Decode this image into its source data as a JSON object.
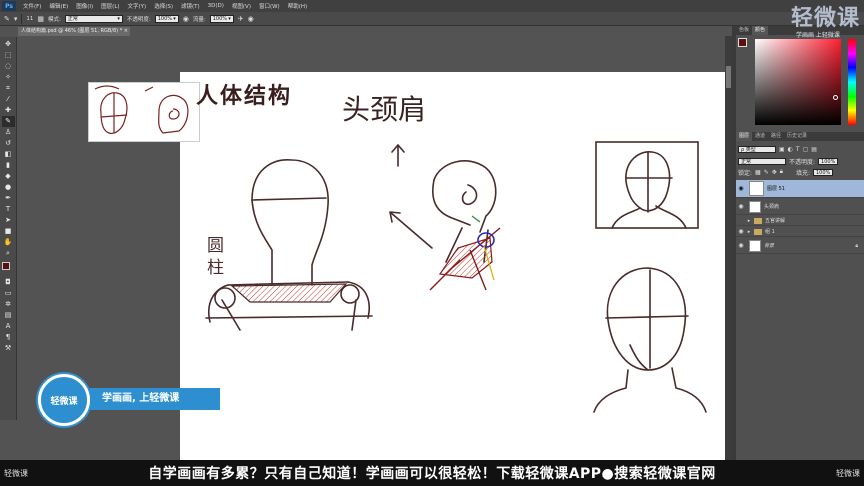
{
  "app": {
    "logo": "Ps"
  },
  "menu": [
    "文件(F)",
    "编辑(E)",
    "图像(I)",
    "图层(L)",
    "文字(Y)",
    "选择(S)",
    "滤镜(T)",
    "3D(D)",
    "视图(V)",
    "窗口(W)",
    "帮助(H)"
  ],
  "options": {
    "brush_size": "11",
    "mode_label": "模式:",
    "mode_value": "正常",
    "opacity_label": "不透明度:",
    "opacity_value": "100%",
    "flow_label": "流量:",
    "flow_value": "100%"
  },
  "document": {
    "tab_title": "人体结构篇.psd @ 46% (图层 51, RGB/8) *",
    "close": "×"
  },
  "canvas_text": {
    "title_main": "人体结构",
    "title_sub": "头颈肩",
    "label_cylinder": "圆柱"
  },
  "color_panel": {
    "tabs": [
      "色板",
      "颜色"
    ],
    "fg_color": "#5a1010"
  },
  "layers_panel": {
    "tabs": [
      "图层",
      "通道",
      "路径",
      "历史记录"
    ],
    "kind_label": "ρ 类型",
    "blend_mode": "正常",
    "opacity_label": "不透明度:",
    "opacity_value": "100%",
    "lock_label": "锁定:",
    "fill_label": "填充:",
    "fill_value": "100%",
    "layers": [
      {
        "name": "图层 51",
        "selected": true,
        "type": "layer"
      },
      {
        "name": "头颈肩",
        "selected": false,
        "type": "layer"
      },
      {
        "name": "五官讲解",
        "selected": false,
        "type": "group"
      },
      {
        "name": "组 1",
        "selected": false,
        "type": "group"
      },
      {
        "name": "背景",
        "selected": false,
        "type": "background"
      }
    ]
  },
  "watermark": {
    "logo": "轻微课",
    "slogan": "学画画 上轻微课"
  },
  "brand": {
    "circle": "轻微课",
    "ribbon": "学画画, 上轻微课"
  },
  "banner": {
    "logo_left": "轻微课",
    "text": "自学画画有多累？只有自己知道！学画画可以很轻松！下载轻微课APP●搜索轻微课官网",
    "logo_right": "轻微课"
  }
}
